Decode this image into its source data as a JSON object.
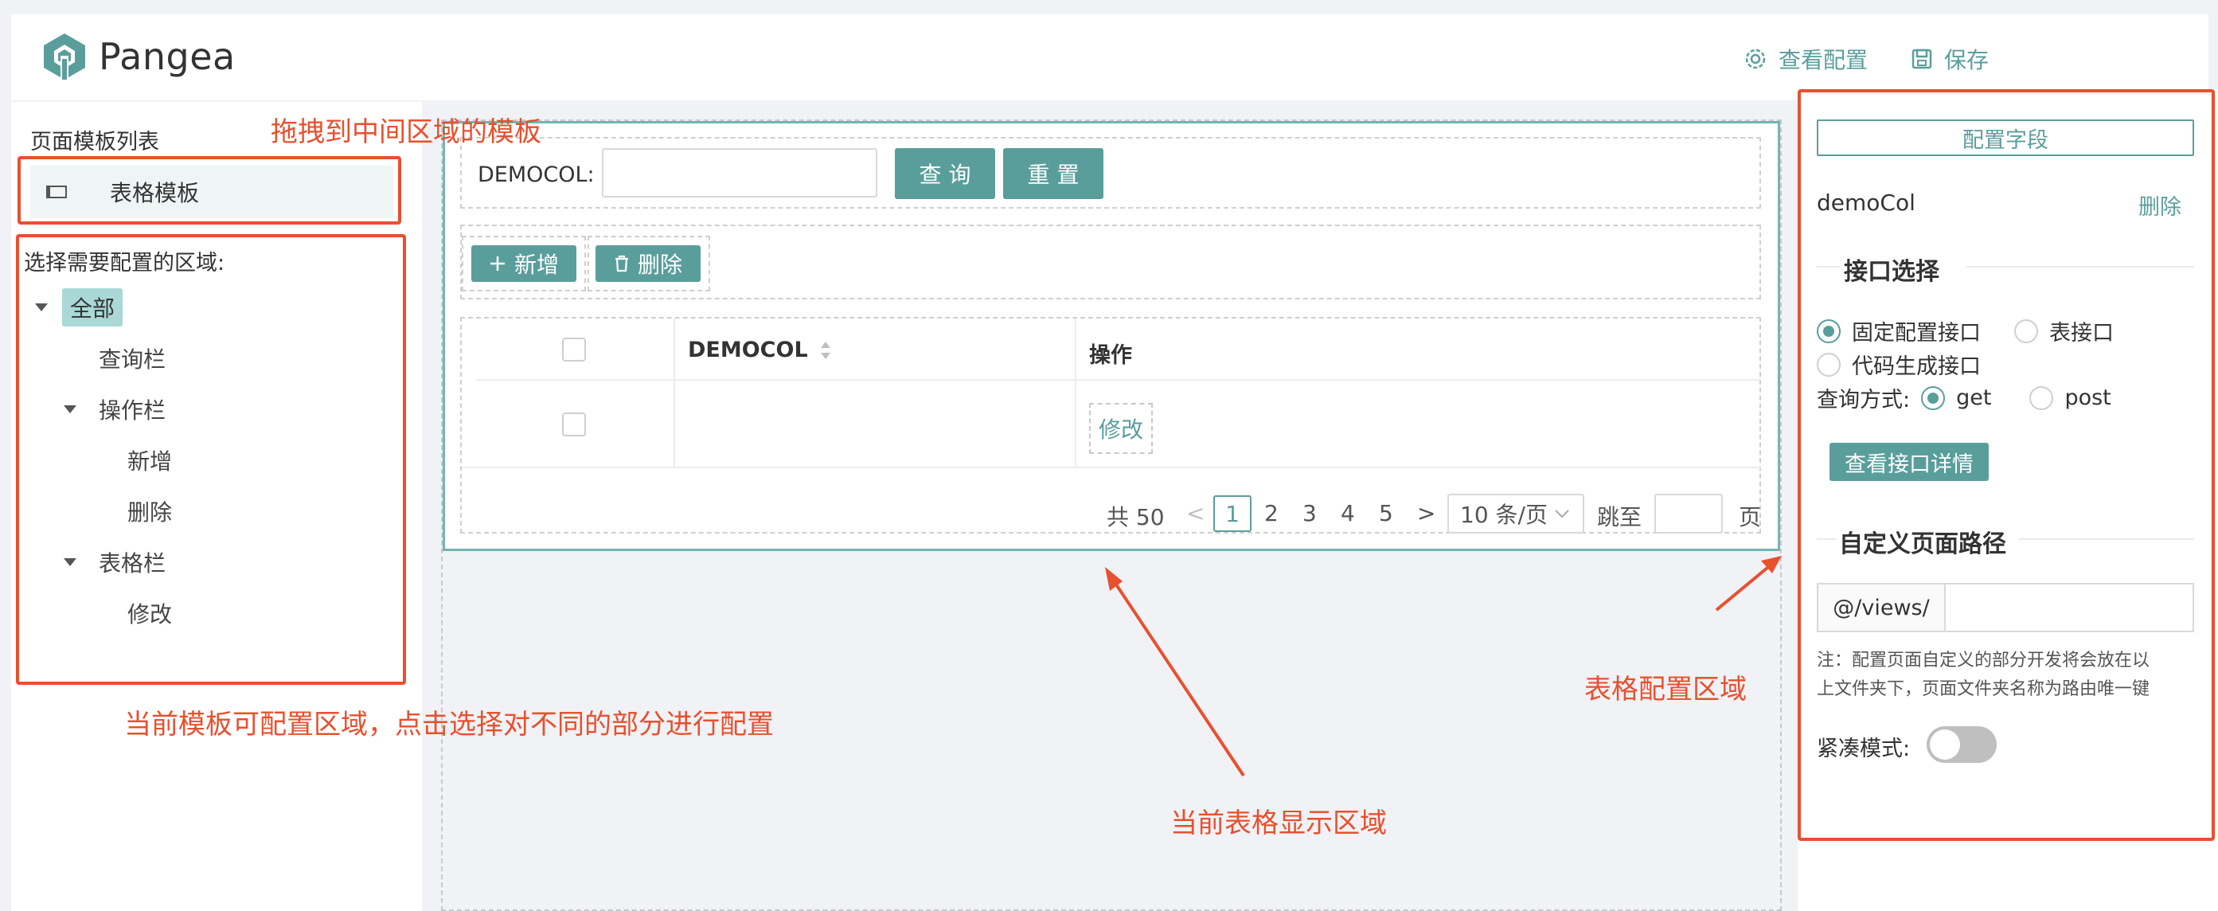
{
  "header": {
    "logo_text": "Pangea",
    "view_config": "查看配置",
    "save": "保存"
  },
  "left_panel": {
    "title": "页面模板列表",
    "template_item": "表格模板",
    "region_prompt": "选择需要配置的区域:",
    "tree": {
      "all": "全部",
      "query_bar": "查询栏",
      "action_bar": "操作栏",
      "add": "新增",
      "delete": "删除",
      "table_bar": "表格栏",
      "edit": "修改"
    }
  },
  "center": {
    "query_label": "DEMOCOL:",
    "query_input_value": "",
    "query_button": "查 询",
    "reset_button": "重 置",
    "add_button": "新增",
    "delete_button": "删除",
    "table": {
      "columns": [
        "DEMOCOL",
        "操作"
      ],
      "row_action": "修改"
    },
    "pagination": {
      "total": "共 50",
      "pages": [
        "1",
        "2",
        "3",
        "4",
        "5"
      ],
      "current_page": "1",
      "page_size": "10 条/页",
      "jump_label": "跳至",
      "jump_suffix": "页"
    }
  },
  "right_panel": {
    "config_field_button": "配置字段",
    "field_name": "demoCol",
    "delete_link": "删除",
    "interface_section": "接口选择",
    "interface_options": [
      "固定配置接口",
      "表接口",
      "代码生成接口"
    ],
    "interface_selected": "固定配置接口",
    "query_method_label": "查询方式:",
    "query_methods": [
      "get",
      "post"
    ],
    "query_method_selected": "get",
    "view_interface_button": "查看接口详情",
    "path_section": "自定义页面路径",
    "path_prefix": "@/views/",
    "path_value": "",
    "note_line1": "注：配置页面自定义的部分开发将会放在以",
    "note_line2": "上文件夹下，页面文件夹名称为路由唯一键",
    "compact_label": "紧凑模式:",
    "compact_on": false
  },
  "annotations": {
    "drag_template": "拖拽到中间区域的模板",
    "configurable_regions": "当前模板可配置区域，点击选择对不同的部分进行配置",
    "table_display": "当前表格显示区域",
    "table_config": "表格配置区域"
  },
  "colors": {
    "accent": "#5a9e9c",
    "annotation": "#e8502e",
    "tree_selected_bg": "#a9d8d6"
  }
}
